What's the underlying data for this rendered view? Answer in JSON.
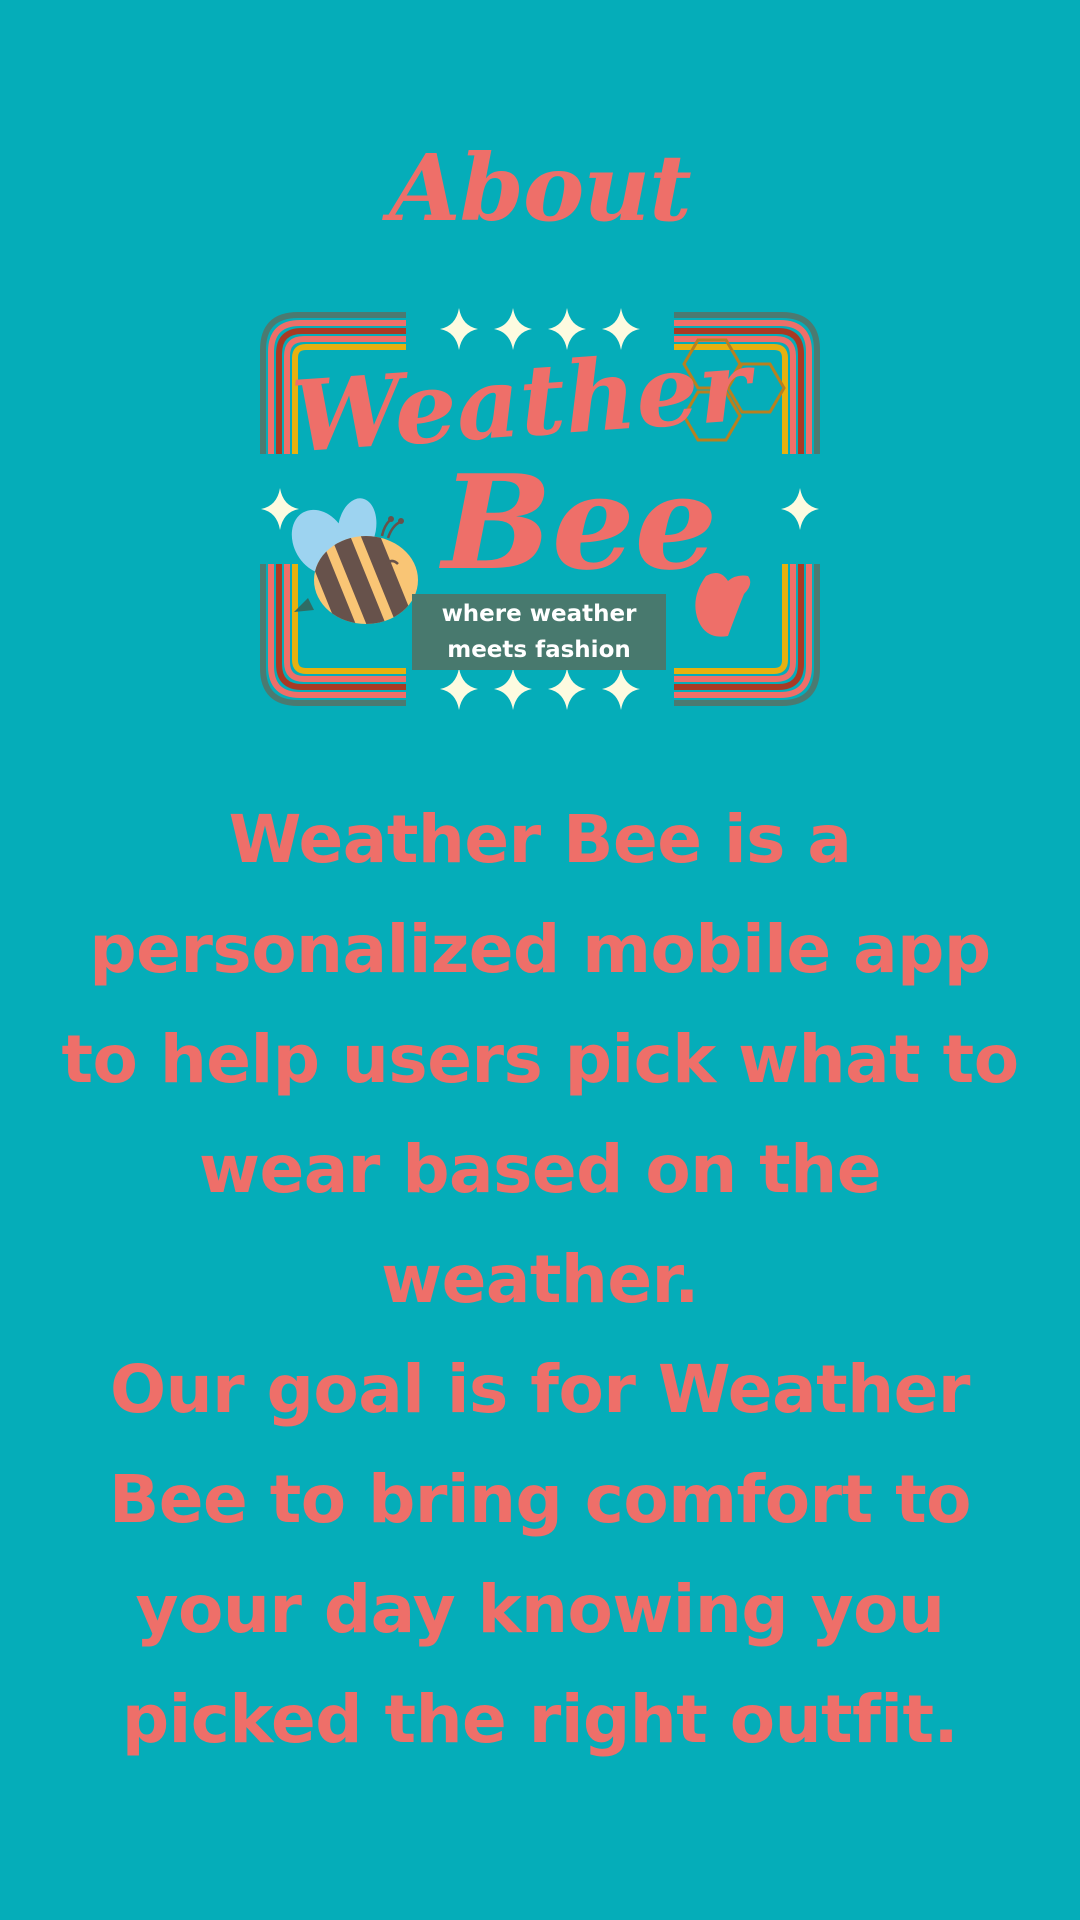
{
  "header": {
    "title": "About"
  },
  "logo": {
    "word_1": "Weather",
    "word_2": "Bee",
    "tagline": "where weather meets fashion",
    "icons": [
      "bee-icon",
      "honeycomb-icon",
      "sparkle-icon",
      "drop-icon"
    ]
  },
  "content": {
    "paragraph_1": "Weather Bee is a personalized mobile app to help users pick what to wear based on the weather.",
    "paragraph_2": "Our goal is for Weather Bee to bring comfort to your day knowing you picked the right outfit."
  },
  "colors": {
    "background": "#05adb9",
    "accent": "#ee6f69",
    "tagline_bg": "#48796e",
    "sparkle": "#fdfbe0"
  }
}
